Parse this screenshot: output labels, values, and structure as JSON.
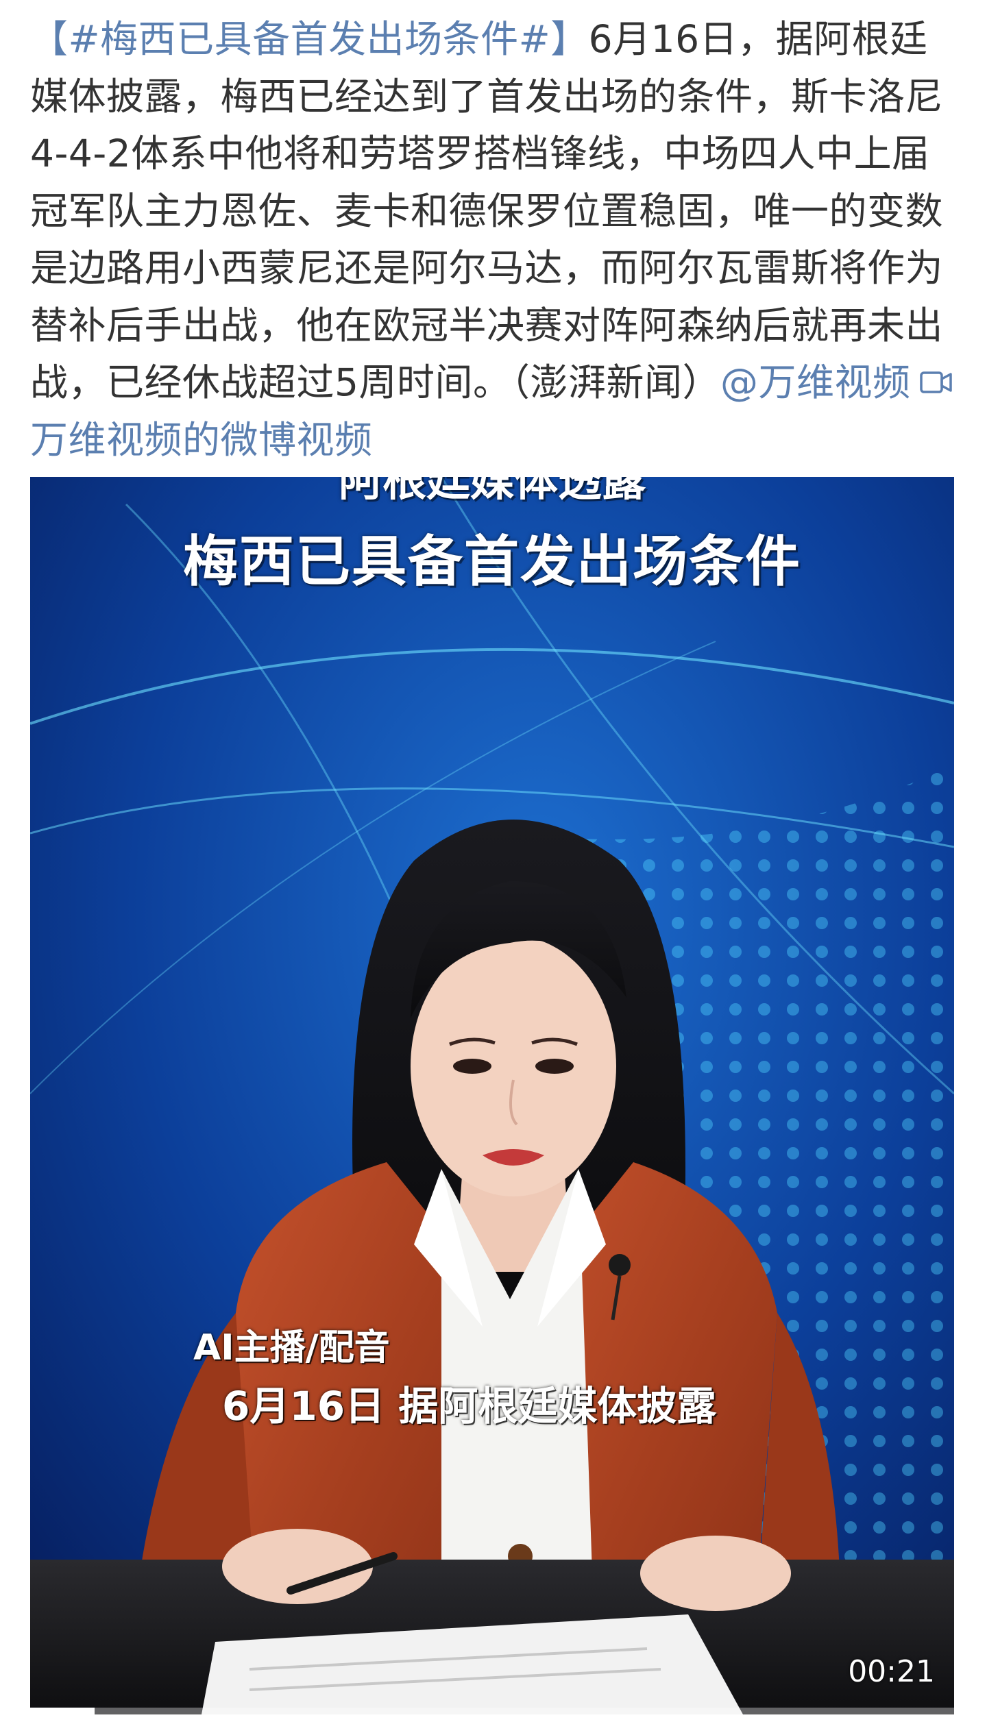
{
  "post": {
    "hashtag": "【#梅西已具备首发出场条件#】",
    "body": "6月16日，据阿根廷媒体披露，梅西已经达到了首发出场的条件，斯卡洛尼4-4-2体系中他将和劳塔罗搭档锋线，中场四人中上届冠军队主力恩佐、麦卡和德保罗位置稳固，唯一的变数是边路用小西蒙尼还是阿尔马达，而阿尔瓦雷斯将作为替补后手出战，他在欧冠半决赛对阵阿森纳后就再未出战，已经休战超过5周时间。（澎湃新闻）",
    "mention": "@万维视频",
    "video_link": "万维视频的微博视频",
    "video_link_icon": "video-camera-icon",
    "link_color": "#5b7fb0"
  },
  "video": {
    "headline_top": "阿根廷媒体透露",
    "headline_main": "梅西已具备首发出场条件",
    "caption_ai": "AI主播/配音",
    "caption_sub": "6月16日 据阿根廷媒体披露",
    "timestamp": "00:21",
    "progress": 0.07
  }
}
